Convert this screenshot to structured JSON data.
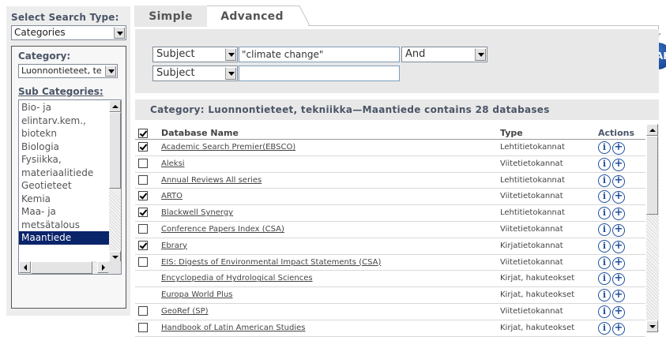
{
  "left_panel": {
    "search_type_label": "Select Search Type:",
    "search_type_value": "Categories",
    "category_label": "Category:",
    "category_value": "Luonnontieteet, te",
    "subcategories_label": "Sub Categories:",
    "subcategories": [
      {
        "label": "Bio- ja",
        "selected": false
      },
      {
        "label": "elintarv.kem.,",
        "selected": false
      },
      {
        "label": "biotekn",
        "selected": false
      },
      {
        "label": "Biologia",
        "selected": false
      },
      {
        "label": "Fysiikka,",
        "selected": false
      },
      {
        "label": "materiaalitiede",
        "selected": false
      },
      {
        "label": "Geotieteet",
        "selected": false
      },
      {
        "label": "Kemia",
        "selected": false
      },
      {
        "label": "Maa- ja",
        "selected": false
      },
      {
        "label": "metsätalous",
        "selected": false
      },
      {
        "label": "Maantiede",
        "selected": true
      }
    ]
  },
  "tabs": [
    {
      "label": "Simple",
      "active": false
    },
    {
      "label": "Advanced",
      "active": true
    }
  ],
  "hab_badge": "HAB",
  "search": {
    "rows": [
      {
        "field": "Subject",
        "term": "\"climate change\"",
        "operator": "And"
      },
      {
        "field": "Subject",
        "term": "",
        "operator": null
      }
    ]
  },
  "results": {
    "header": "Category: Luonnontieteet, tekniikka—Maantiede contains 28 databases",
    "columns": {
      "name": "Database Name",
      "type": "Type",
      "actions": "Actions"
    },
    "header_checked": true,
    "rows": [
      {
        "name": "Academic Search Premier(EBSCO)",
        "type": "Lehtitietokannat",
        "checkbox": true,
        "checked": true
      },
      {
        "name": "Aleksi",
        "type": "Viitetietokannat",
        "checkbox": true,
        "checked": false
      },
      {
        "name": "Annual Reviews All series",
        "type": "Lehtitietokannat",
        "checkbox": true,
        "checked": false
      },
      {
        "name": "ARTO",
        "type": "Viitetietokannat",
        "checkbox": true,
        "checked": true
      },
      {
        "name": "Blackwell Synergy",
        "type": "Lehtitietokannat",
        "checkbox": true,
        "checked": true
      },
      {
        "name": "Conference Papers Index (CSA)",
        "type": "Viitetietokannat",
        "checkbox": true,
        "checked": false
      },
      {
        "name": "Ebrary",
        "type": "Kirjatietokannat",
        "checkbox": true,
        "checked": true
      },
      {
        "name": "EIS: Digests of Environmental Impact Statements (CSA)",
        "type": "Viitetietokannat",
        "checkbox": true,
        "checked": false
      },
      {
        "name": "Encyclopedia of Hydrological Sciences",
        "type": "Kirjat, hakuteokset",
        "checkbox": false,
        "checked": false
      },
      {
        "name": "Europa World Plus",
        "type": "Kirjat, hakuteokset",
        "checkbox": false,
        "checked": false
      },
      {
        "name": "GeoRef (SP)",
        "type": "Viitetietokannat",
        "checkbox": true,
        "checked": false
      },
      {
        "name": "Handbook of Latin American Studies",
        "type": "Kirjat, hakuteokset",
        "checkbox": true,
        "checked": false
      }
    ]
  },
  "icons": {
    "info": "info-icon",
    "add": "plus-icon"
  },
  "colors": {
    "label_text": "#4a5566",
    "panel_bg": "#e8e8e8",
    "selected_item_bg": "#0a246a",
    "action_icon": "#1f4fa0"
  }
}
